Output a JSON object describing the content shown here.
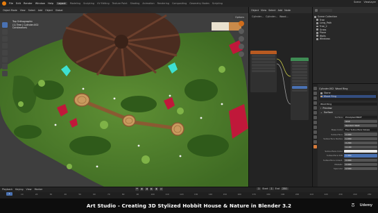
{
  "topbar": {
    "menus": [
      "File",
      "Edit",
      "Render",
      "Window",
      "Help"
    ],
    "workspaces": [
      "Layout",
      "Modeling",
      "Sculpting",
      "UV Editing",
      "Texture Paint",
      "Shading",
      "Animation",
      "Rendering",
      "Compositing",
      "Geometry Nodes",
      "Scripting"
    ],
    "active_workspace": "Layout",
    "scene_label": "Scene",
    "view_layer_label": "ViewLayer"
  },
  "viewport": {
    "mode": "Object Mode",
    "header_items": [
      "View",
      "Select",
      "Add",
      "Object"
    ],
    "global_label": "Global",
    "options_label": "Options",
    "info_line1": "Top Orthographic",
    "info_line2": "(1) Tree | Cylinder.002",
    "info_line3": "Centimeters"
  },
  "node_editor": {
    "header_items": [
      "Object",
      "View",
      "Select",
      "Add",
      "Node"
    ],
    "breadcrumb": [
      "Cylinder...",
      "Cylinder...",
      "Wood..."
    ]
  },
  "outliner": {
    "title": "Scene Collection",
    "items": [
      {
        "label": "Scene Collection",
        "selected": false
      },
      {
        "label": "Tree",
        "selected": false
      },
      {
        "label": "Long_Path",
        "selected": false
      },
      {
        "label": "Tree_2",
        "selected": false
      },
      {
        "label": "Grass",
        "selected": false
      },
      {
        "label": "Plane",
        "selected": false
      },
      {
        "label": "Walls",
        "selected": false
      },
      {
        "label": "Windows",
        "selected": false
      }
    ]
  },
  "properties": {
    "object_name": "Cylinder.002",
    "material_tab": "Wood Ring",
    "slot_labels": [
      "Stone",
      "Wood Ring"
    ],
    "material_name": "Wood Ring",
    "preview_label": "Preview",
    "surface_label": "Surface",
    "rows": [
      {
        "label": "Surface",
        "value": "Principled BSDF",
        "style": "dark"
      },
      {
        "label": "",
        "value": "GGX",
        "style": "normal"
      },
      {
        "label": "",
        "value": "Random Walk",
        "style": "normal"
      },
      {
        "label": "Base Color",
        "value": "Four Subsurface Values",
        "style": "dark"
      },
      {
        "label": "Subsurface",
        "value": "0.000",
        "style": "normal"
      },
      {
        "label": "Subsurface Radius",
        "value": "1.000",
        "style": "normal"
      },
      {
        "label": "",
        "value": "0.200",
        "style": "normal"
      },
      {
        "label": "",
        "value": "0.100",
        "style": "normal"
      },
      {
        "label": "Subsurface Color",
        "value": "",
        "style": "color"
      },
      {
        "label": "Subsurface IOR",
        "value": "1.400",
        "style": "blue"
      },
      {
        "label": "Subsurface Anisot.",
        "value": "0.000",
        "style": "normal"
      },
      {
        "label": "Metallic",
        "value": "0.000",
        "style": "normal"
      },
      {
        "label": "Specular",
        "value": "0.500",
        "style": "normal"
      }
    ],
    "colors": {
      "subsurface": "#e8e8e8"
    }
  },
  "timeline": {
    "menus": [
      "Playback",
      "Keying",
      "View",
      "Marker"
    ],
    "current_frame": "1",
    "start_label": "Start",
    "start_value": "1",
    "end_label": "End",
    "end_value": "250",
    "ticks": [
      "10",
      "20",
      "30",
      "40",
      "50",
      "60",
      "70",
      "80",
      "90",
      "100",
      "110",
      "120",
      "130",
      "140",
      "150",
      "160",
      "170",
      "180",
      "190",
      "200",
      "210",
      "220",
      "230",
      "240",
      "250"
    ]
  },
  "caption": {
    "text": "Art Studio - Creating 3D Stylized Hobbit House & Nature in Blender 3.2",
    "brand": "Udemy"
  }
}
